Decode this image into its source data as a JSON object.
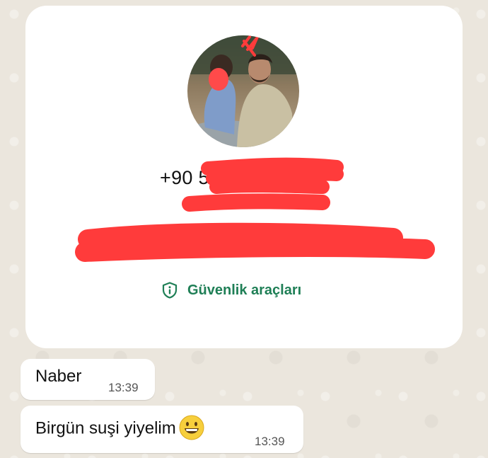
{
  "contact": {
    "phone_visible": "+90 5",
    "avatar_icon": "profile-photo",
    "security_tools_label": "Güvenlik araçları",
    "security_icon": "shield-info-icon",
    "redaction_color": "#ff3b3b",
    "accent_color": "#1f7f56"
  },
  "messages": [
    {
      "text": "Naber",
      "time": "13:39"
    },
    {
      "text": "Birgün suşi yiyelim",
      "emoji": "grinning-face-emoji",
      "time": "13:39"
    }
  ]
}
